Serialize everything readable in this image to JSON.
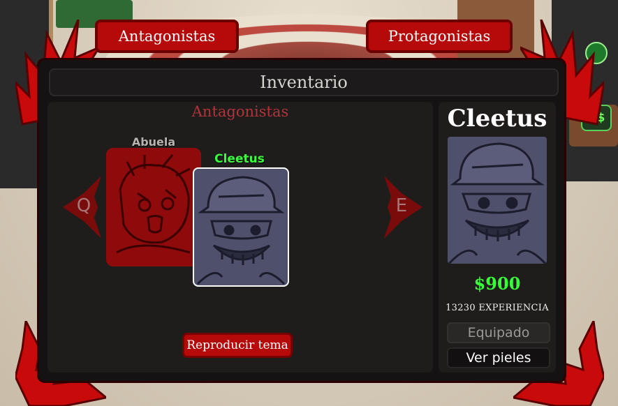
{
  "tabs": {
    "antagonists": "Antagonistas",
    "protagonists": "Protagonistas"
  },
  "inventory": {
    "title": "Inventario",
    "section_heading": "Antagonistas",
    "nav_prev_key": "Q",
    "nav_next_key": "E",
    "cards": [
      {
        "name": "Abuela",
        "state": "locked"
      },
      {
        "name": "Cleetus",
        "state": "selected"
      }
    ],
    "play_theme_label": "Reproducir tema"
  },
  "details": {
    "name": "Cleetus",
    "price": "$900",
    "experience": "13230 EXPERIENCIA",
    "equip_label": "Equipado",
    "skins_label": "Ver pieles"
  },
  "hud": {
    "currency_label": "R$"
  },
  "colors": {
    "accent_red": "#b60a0a",
    "price_green": "#39ff39",
    "selected_green": "#3bff3b",
    "panel_bg": "#1f1c1c"
  }
}
